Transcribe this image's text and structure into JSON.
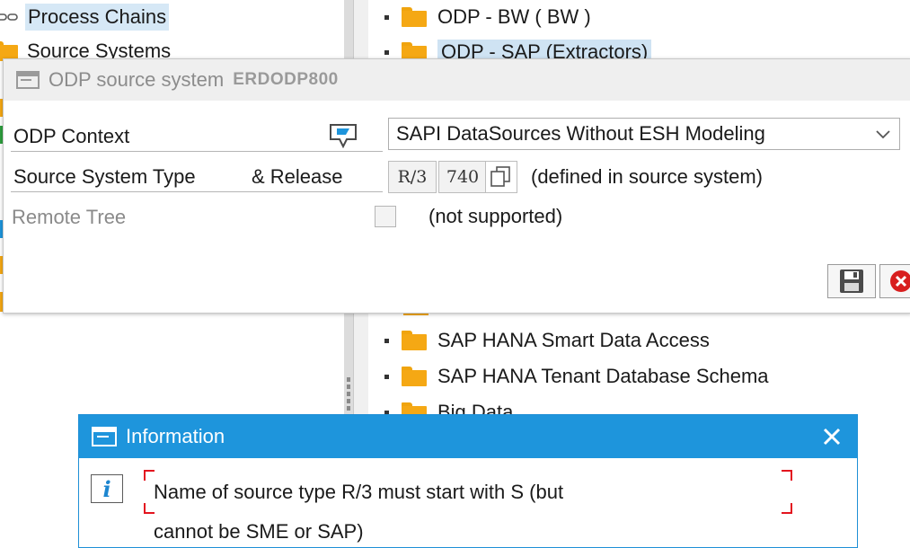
{
  "left_tree": {
    "items": [
      {
        "label": "Process Chains",
        "icon": "process-chain-icon",
        "selected": true
      },
      {
        "label": "Source Systems",
        "icon": "folder-icon",
        "selected": false
      }
    ]
  },
  "right_tree": {
    "items": [
      {
        "label": "ODP - BW ( BW )"
      },
      {
        "label": "ODP - SAP (Extractors)",
        "selected": true
      },
      {
        "label": "SAP HANA Smart Data Access"
      },
      {
        "label": "SAP HANA Tenant Database Schema"
      },
      {
        "label": "Big Data"
      }
    ]
  },
  "odp_dialog": {
    "title": "ODP source system",
    "system_id": "ERDODP800",
    "odp_context_label": "ODP Context",
    "odp_context_value": "SAPI DataSources Without ESH Modeling",
    "source_system_type_label": "Source System Type",
    "release_label": "& Release",
    "type_value": "R/3",
    "release_value": "740",
    "defined_note": "(defined in source system)",
    "remote_tree_label": "Remote Tree",
    "remote_tree_note": "(not supported)",
    "remote_tree_checked": false
  },
  "info_popup": {
    "title": "Information",
    "message_line1": "Name of source type R/3 must start with S (but",
    "message_line2": "cannot be SME or SAP)"
  },
  "colors": {
    "accent": "#1e95dc",
    "folder": "#f5a814",
    "selection": "#d6e8f6",
    "error_red": "#e3141f"
  }
}
